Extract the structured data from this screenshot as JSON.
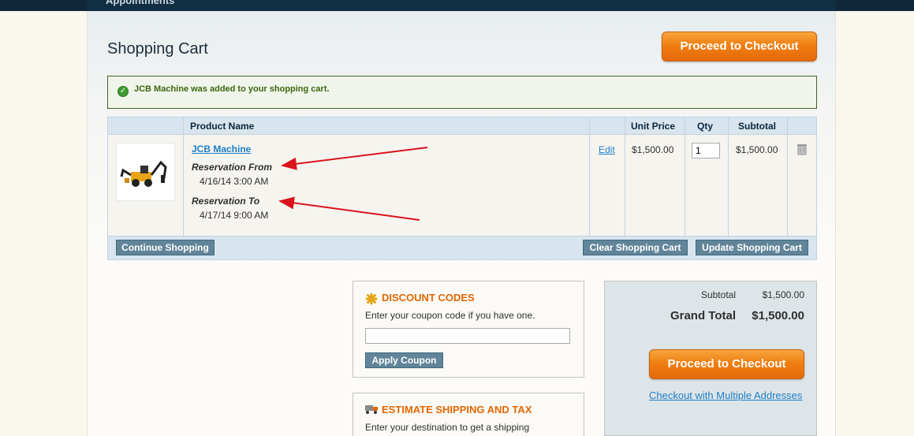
{
  "nav": {
    "item": "Appointments"
  },
  "page": {
    "title": "Shopping Cart",
    "checkout_top": "Proceed to Checkout"
  },
  "message": {
    "text": "JCB Machine was added to your shopping cart.",
    "icon": "success-check-icon"
  },
  "cart": {
    "headers": {
      "product": "Product Name",
      "unit_price": "Unit Price",
      "qty": "Qty",
      "subtotal": "Subtotal"
    },
    "item": {
      "name": "JCB Machine",
      "options": [
        {
          "label": "Reservation From",
          "value": "4/16/14 3:00 AM"
        },
        {
          "label": "Reservation To",
          "value": "4/17/14 9:00 AM"
        }
      ],
      "edit": "Edit",
      "unit_price": "$1,500.00",
      "qty": "1",
      "subtotal": "$1,500.00"
    },
    "buttons": {
      "continue": "Continue Shopping",
      "clear": "Clear Shopping Cart",
      "update": "Update Shopping Cart"
    }
  },
  "discount": {
    "title": "DISCOUNT CODES",
    "text": "Enter your coupon code if you have one.",
    "button": "Apply Coupon"
  },
  "shipping": {
    "title": "ESTIMATE SHIPPING AND TAX",
    "text": "Enter your destination to get a shipping"
  },
  "totals": {
    "subtotal_label": "Subtotal",
    "subtotal_value": "$1,500.00",
    "grand_label": "Grand Total",
    "grand_value": "$1,500.00",
    "checkout": "Proceed to Checkout",
    "multi": "Checkout with Multiple Addresses"
  },
  "colors": {
    "accent": "#f07f12",
    "link": "#1e7ec8",
    "arrow": "#d9131b"
  }
}
